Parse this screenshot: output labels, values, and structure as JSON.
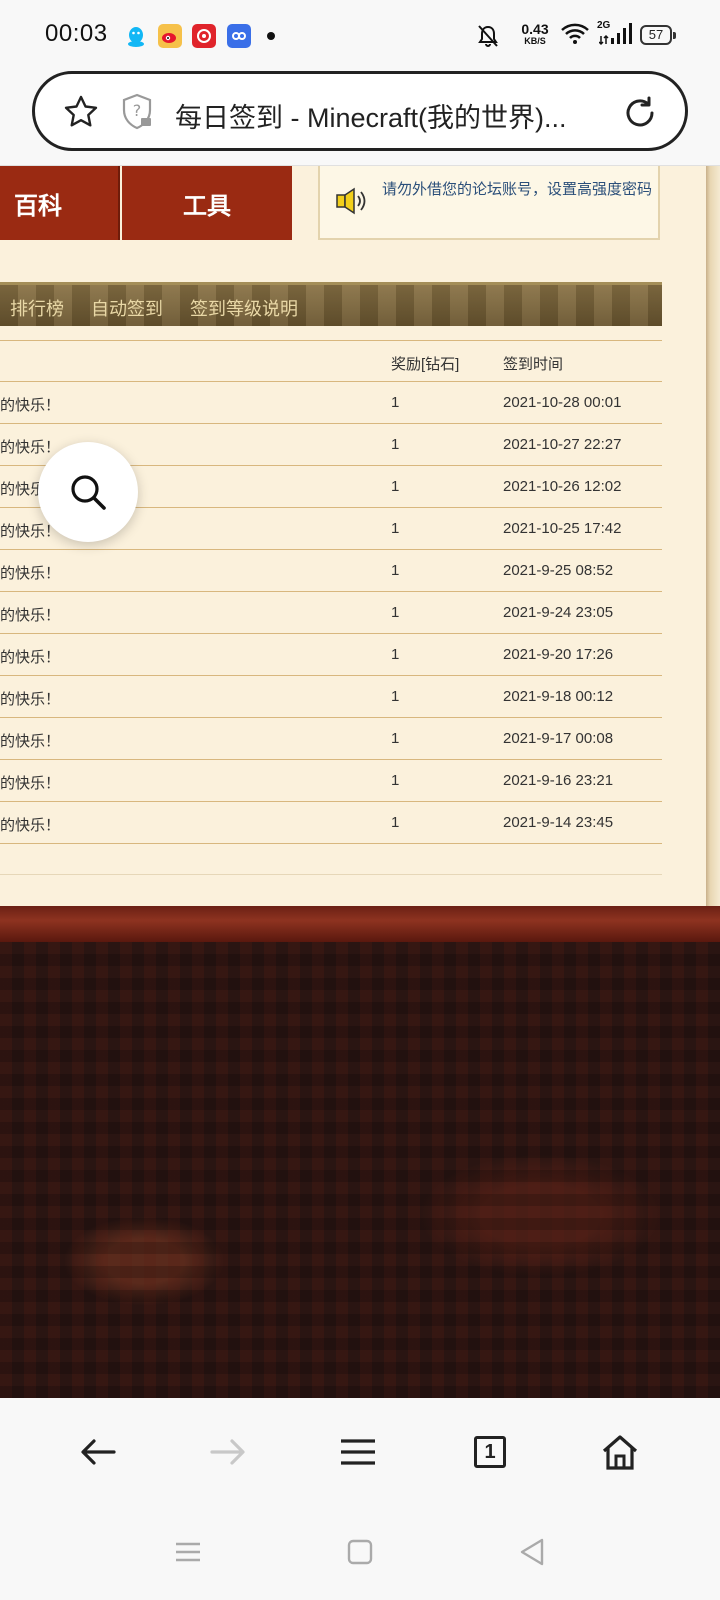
{
  "status_bar": {
    "time": "00:03",
    "net_speed_value": "0.43",
    "net_speed_unit": "KB/S",
    "network_type": "2G",
    "battery": "57"
  },
  "address_bar": {
    "title": "每日签到 - Minecraft(我的世界)..."
  },
  "nav_tabs": [
    "百科",
    "工具"
  ],
  "notice": "请勿外借您的论坛账号，设置高强度密码",
  "subnav": [
    "排行榜",
    "自动签到",
    "签到等级说明"
  ],
  "table": {
    "headers": [
      "奖励[钻石]",
      "签到时间"
    ],
    "rows": [
      {
        "message": "的快乐！",
        "reward": "1",
        "time": "2021-10-28 00:01"
      },
      {
        "message": "的快乐！",
        "reward": "1",
        "time": "2021-10-27 22:27"
      },
      {
        "message": "的快乐",
        "reward": "1",
        "time": "2021-10-26 12:02"
      },
      {
        "message": "的快乐！",
        "reward": "1",
        "time": "2021-10-25 17:42"
      },
      {
        "message": "的快乐！",
        "reward": "1",
        "time": "2021-9-25 08:52"
      },
      {
        "message": "的快乐！",
        "reward": "1",
        "time": "2021-9-24 23:05"
      },
      {
        "message": "的快乐！",
        "reward": "1",
        "time": "2021-9-20 17:26"
      },
      {
        "message": "的快乐！",
        "reward": "1",
        "time": "2021-9-18 00:12"
      },
      {
        "message": "的快乐！",
        "reward": "1",
        "time": "2021-9-17 00:08"
      },
      {
        "message": "的快乐！",
        "reward": "1",
        "time": "2021-9-16 23:21"
      },
      {
        "message": "的快乐！",
        "reward": "1",
        "time": "2021-9-14 23:45"
      }
    ]
  },
  "toolbar": {
    "tab_count": "1"
  },
  "icons": {
    "status_apps": [
      "qq-icon",
      "weibo-icon",
      "netease-music-icon",
      "link-app-icon"
    ],
    "address": [
      "star-icon",
      "shield-question-icon",
      "reload-icon"
    ],
    "toolbar": [
      "back-arrow-icon",
      "forward-arrow-icon",
      "menu-icon",
      "tabs-icon",
      "home-icon"
    ],
    "system_nav": [
      "recents-icon",
      "home-square-icon",
      "back-triangle-icon"
    ]
  },
  "colors": {
    "nav_tab_bg": "#9a2a12",
    "page_bg": "#fbf1dc",
    "notice_text": "#2b4f7a",
    "subnav_text": "#e9d8a6"
  }
}
